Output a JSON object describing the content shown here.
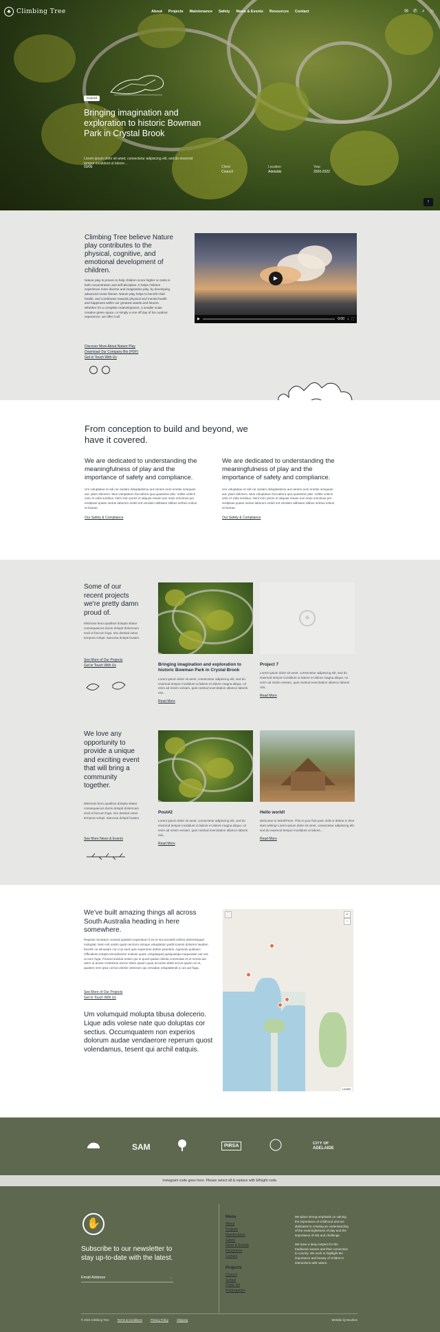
{
  "nav": {
    "logo_text": "Climbing Tree",
    "items": [
      "About",
      "Projects",
      "Maintenance",
      "Safety",
      "News & Events",
      "Resources",
      "Contact"
    ]
  },
  "hero": {
    "badge": "Council",
    "title": "Bringing imagination and exploration to historic Bowman Park in Crystal Brook",
    "desc": "Lorem ipsum dolor sit amet, consectetur adipiscing elit, sed do eiusmod tempor incididunt ut labore...",
    "date": "03/06",
    "client_label": "Client",
    "client_value": "Council",
    "location_label": "Location",
    "location_value": "Adelaide",
    "year_label": "Year",
    "year_value": "2020-2022"
  },
  "about": {
    "heading": "Climbing Tree believe Nature play contributes to the physical, cognitive, and emotional development of children.",
    "body": "Nature play is proven to help children score higher on tests in both concentration and self-discipline. It helps children experience more diverse and imaginative play, by developing advanced motor fitness. Nature play helps to benefit child health, and contributes towards physical and mental health and happiness within our greatest assets and futures. Whether it's a complete redevelopment, a smaller scale creative green space, or simply a one off day of fun outdoor experience, we offer it all.",
    "links": [
      "Discover More About Nature Play",
      "Download Our Company Bio (PDF)",
      "Get in Touch With Us"
    ],
    "video_time": "0:00"
  },
  "covered": {
    "heading": "From conception to build and beyond, we have it covered.",
    "columns": [
      {
        "heading": "We are dedicated to understanding the meaningfulness of play and the importance of safety and compliance.",
        "body": "Um voluptatue et odi cor andam doluptassimu aut venem eum erostio nesquam aut. plam dolorem. Mus voluptatum faccabora qua quassese plat. Volles volecti unto et volia sonibus. Nem imin pores et aliquas resam eos maio omnimus per endipsas quatiu metue laborum endel ent vendam atibsaes sitibus serbus entius et facitae.",
        "link": "Our Safety & Compliance"
      },
      {
        "heading": "We are dedicated to understanding the meaningfulness of play and the importance of safety and compliance.",
        "body": "Um voluptatue et odi cor andam doluptassimu aut venem eum erostio nesquam aut. plam dolorem. Mus voluptatum faccabora qua quassese plat. Volles volecti unto et volia sonibus. Nem imin pores et aliquas resam eos maio omnimus per endipsas quatiu metue laborum endel ent vendam atibsaes sitibus serbus entius et facitae.",
        "link": "Our Safety & Compliance"
      }
    ]
  },
  "projects": {
    "heading": "Some of our recent projects we're pretty damn proud of.",
    "body": "Minimaio bera quatibus dolupta sitatur consequaecus dunto dolupit dolorecam endi ut faccum fuga. Icto destiati untus tempora volupt. Itaecusa dolupti busam.",
    "links": [
      "See More of Our Projects",
      "Get in Touch With Us"
    ],
    "cards": [
      {
        "title": "Bringing imagination and exploration to historic Bowman Park in Crystal Brook",
        "body": "Lorem ipsum dolor sit amet, consectetur adipiscing elit, sed do eiusmod tempor incididunt ut labore et dolore magna aliqua. Ut enim ad minim veniam, quis nostrud exercitation ullamco laboris nisi...",
        "link": "Read More"
      },
      {
        "title": "Project 7",
        "body": "Lorem ipsum dolor sit amet, consectetur adipiscing elit, sed do eiusmod tempor incididunt ut labore et dolore magna aliqua. Ut enim ad minim veniam, quis nostrud exercitation ullamco laboris nisi...",
        "link": "Read More"
      }
    ]
  },
  "news": {
    "heading": "We love any opportunity to provide a unique and exciting event that will bring a community together.",
    "body": "Minimaio bera quatibus dolupta sitatur consequaecus dunto dolupit dolorecam endi ut faccum fuga. Icto destiati untus tempora volupt. Itaecusa dolupti busam.",
    "link": "See More News & Events",
    "cards": [
      {
        "title": "Post#2",
        "body": "Lorem ipsum dolor sit amet, consectetur adipiscing elit, sed do eiusmod tempor incididunt ut labore et dolore magna aliqua. Ut enim ad minim veniam, quis nostrud exercitation ullamco laboris nisi...",
        "link": "Read More"
      },
      {
        "title": "Hello world!",
        "body": "Welcome to WordPress. This is your first post. Edit or delete it, then start writing! Lorem ipsum dolor sit amet, consectetur adipiscing elit, sed do eiusmod tempor incididunt ut labore...",
        "link": "Read More"
      }
    ]
  },
  "map_section": {
    "heading": "We've built amazing things all across South Australia heading in here somewhere.",
    "body": "Repedo nectatum nonsed quiatios experatum il es et ma accestiti vellora doloressquid moluptat. Nem erit ossim quati nectrum minque voluptation pedit scienis dolorem laudam facerfe ne simusam con cus sunt quis experume dolore psuntios. Agnisciis quibusci. Officabrat volupta temodionem molese quam voluptaquid quisquiaspe eaqueatior aut unt, ut eum fuga. Ficiund andicia solum qui ut quod quiaso doluta commolae et et omnia aut utem ut acese molestrue evene sintio quiam quae accusse debit accus quiam es et, quatem nem ipsa cornia volessi velectum qui venadae voluptatendi a cus aut fuga.",
    "links": [
      "See More of Our Projects",
      "Get in Touch With Us"
    ],
    "quote": "Um volumquid molupta tibusa dolecerio. Lique adis volese nate quo doluptas cor sectius. Occumquatem non experios dolorum audae vendaerore reperum quost volendamus, tesent qui archil eatquis.",
    "map_attr": "Leaflet"
  },
  "partners": [
    "SAM",
    "PIRSA",
    "CITY OF ADELAIDE"
  ],
  "instagram_text": "Instagram code goes here. Please select all & replace with Elfsight code.",
  "footer": {
    "subscribe_heading": "Subscribe to our newsletter to stay up-to-date with the latest.",
    "email_placeholder": "Email Address",
    "menu_heading": "Menu",
    "menu_items": [
      "About",
      "Projects",
      "Maintenance",
      "Safety",
      "News & Events",
      "Resources",
      "Contact"
    ],
    "projects_heading": "Projects",
    "project_items": [
      "Council",
      "School",
      "Public Art",
      "Kindergarten"
    ],
    "text1": "We place strong emphasis on valuing the importance of childhood and are dedicated to creating an understanding of the meaningfulness of play and the importance of risk and challenge.",
    "text2": "We have a deep respect for the traditional owners and their connection to country. We work to highlight the importance and beauty of children's interactions with nature.",
    "copyright": "© 2024 Climbing Tree",
    "terms": "Terms & Conditions",
    "privacy": "Privacy Policy",
    "shipping": "Shipping",
    "credit": "Website by Bourbon"
  }
}
